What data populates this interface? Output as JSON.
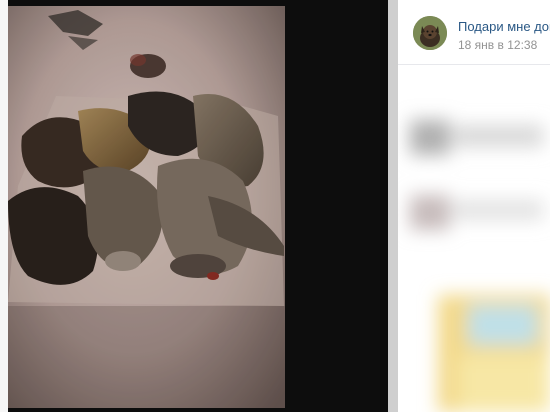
{
  "post": {
    "author_name": "Подари мне дом",
    "date": "18 янв в 12:38"
  },
  "photo": {
    "description_icon": "photo-image"
  },
  "icons": {
    "avatar": "dog-avatar-icon"
  },
  "colors": {
    "link": "#2a5885",
    "meta": "#939393",
    "viewer_bg": "#0d0d0d"
  }
}
